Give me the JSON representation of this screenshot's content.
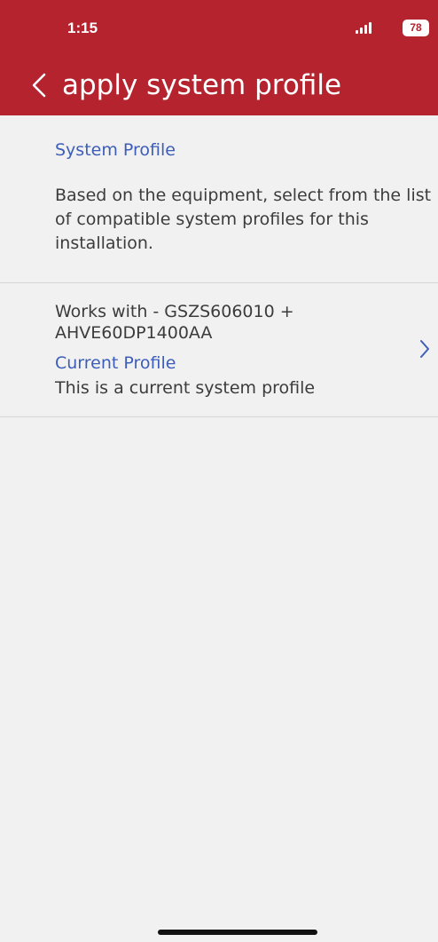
{
  "status_bar": {
    "time": "1:15",
    "battery": "78"
  },
  "nav": {
    "title": "apply system profile"
  },
  "section": {
    "title": "System Profile",
    "description": "Based on the equipment, select from the list of compatible system profiles for this installation."
  },
  "profile": {
    "equipment": "Works with - GSZS606010 + AHVE60DP1400AA",
    "label": "Current Profile",
    "description": "This is a current system profile"
  },
  "icons": {
    "back": "chevron-left-icon",
    "row_arrow": "chevron-right-icon",
    "signal": "cellular-signal-icon",
    "battery": "battery-icon"
  },
  "colors": {
    "header_bg": "#b4232e",
    "accent_text": "#3d5eb8",
    "background": "#f1f1f1"
  }
}
